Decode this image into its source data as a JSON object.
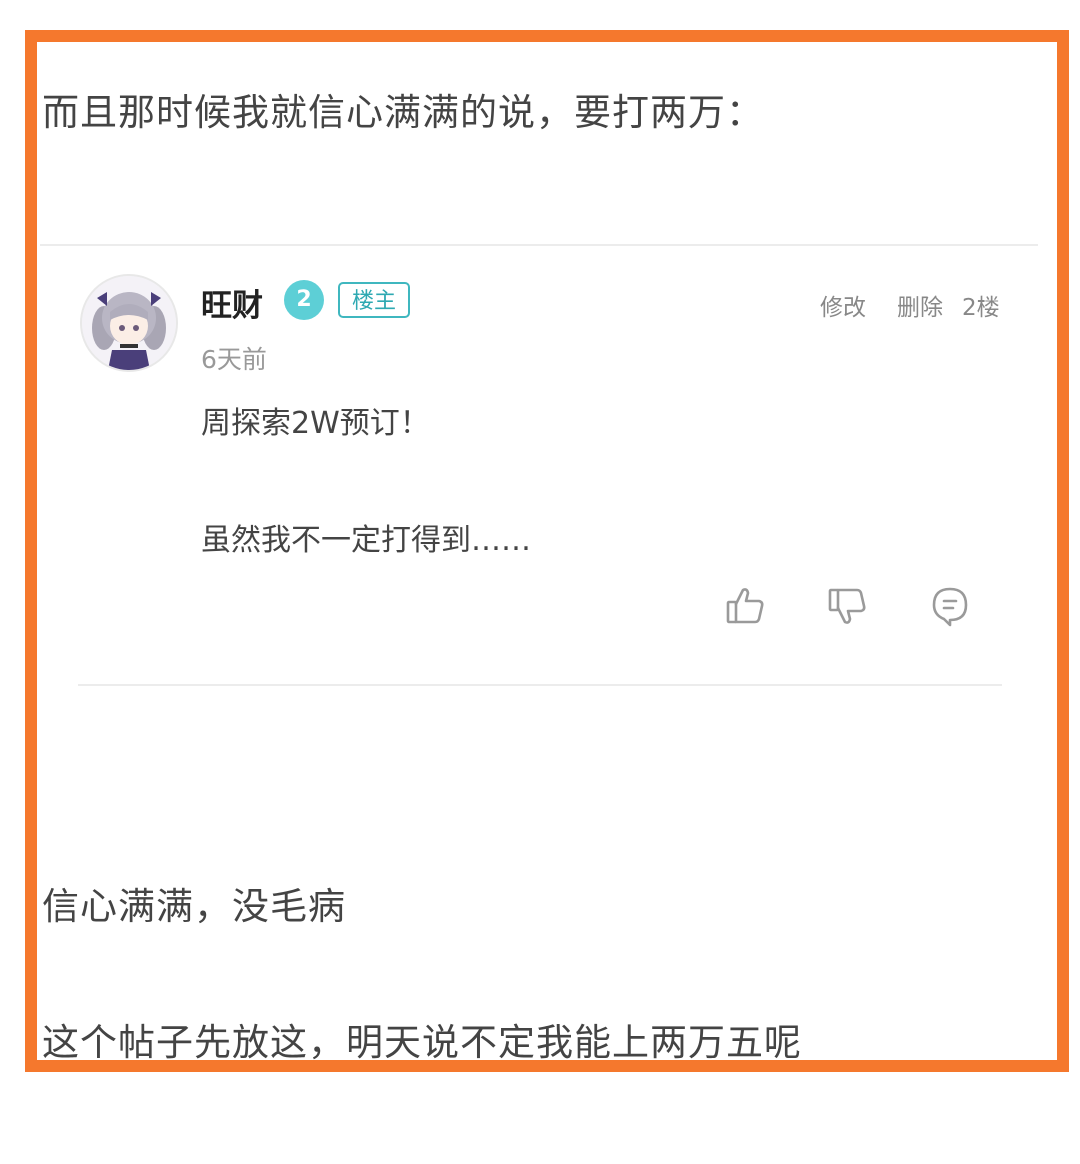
{
  "post": {
    "paragraph_1": "而且那时候我就信心满满的说，要打两万：",
    "paragraph_2": "信心满满，没毛病",
    "paragraph_3": "这个帖子先放这，明天说不定我能上两万五呢"
  },
  "comment": {
    "username": "旺财",
    "level": "2",
    "op_tag": "楼主",
    "time": "6天前",
    "edit_label": "修改",
    "delete_label": "删除",
    "floor": "2楼",
    "lines": [
      "周探索2W预订！",
      "虽然我不一定打得到……"
    ],
    "icons": [
      "thumbs-up-icon",
      "thumbs-down-icon",
      "reply-bubble-icon"
    ]
  },
  "colors": {
    "frame": "#f5782d",
    "accent": "#5dcfd6",
    "op_tag": "#3fb7bf",
    "icon": "#9a9a9a"
  }
}
